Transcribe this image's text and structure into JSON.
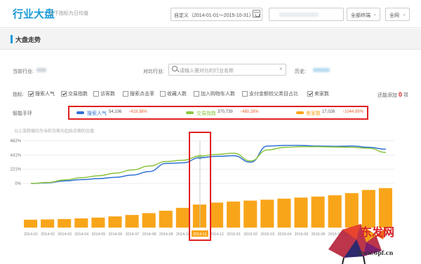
{
  "header": {
    "title": "行业大盘",
    "subtitle": "以下指标为日均值",
    "date_range": "自定义（2014-01-01～2015-10-31）",
    "terminal_select": "全部终端",
    "network_select": "全网"
  },
  "section": {
    "title": "大盘走势"
  },
  "filters": {
    "current_industry_label": "当前行业:",
    "compare_label": "对比行业:",
    "search_placeholder": "请输入需对比的行业名称",
    "history_label": "历史:"
  },
  "metrics": {
    "label": "指标:",
    "items": [
      {
        "label": "搜索人气",
        "checked": true
      },
      {
        "label": "交易指数",
        "checked": true
      },
      {
        "label": "访客数",
        "checked": false
      },
      {
        "label": "搜索点击率",
        "checked": false
      },
      {
        "label": "收藏人数",
        "checked": false
      },
      {
        "label": "加入购物车人数",
        "checked": false
      },
      {
        "label": "支付金额较父类目占比",
        "checked": false
      },
      {
        "label": "卖家数",
        "checked": true
      }
    ],
    "added_label": "还能添加",
    "added_count": "0",
    "added_unit": "项"
  },
  "legend": {
    "label": "智能手环",
    "series": [
      {
        "name": "搜索人气",
        "value": "54,106",
        "change": "419.38%",
        "color": "#2f72d4"
      },
      {
        "name": "交易指数",
        "value": "370,739",
        "change": "480.28%",
        "color": "#8dc63f"
      },
      {
        "name": "卖家数",
        "value": "17,026",
        "change": "1044.99%",
        "color": "#f9a51a"
      }
    ]
  },
  "note": "以上涨跌幅均为当前日期与起始日期的比值",
  "chart_data": {
    "type": "bar",
    "yticks": [
      "662%",
      "441%",
      "221%",
      "0%"
    ],
    "ylim": [
      0,
      662
    ],
    "categories": [
      "2014-01",
      "2014-02",
      "2014-03",
      "2014-04",
      "2014-05",
      "2014-06",
      "2014-07",
      "2014-08",
      "2014-09",
      "2014-10",
      "2014-11",
      "2014-12",
      "2015-01",
      "2015-02",
      "2015-03",
      "2015-04",
      "2015-05",
      "2015-06",
      "2015-07",
      "2015-08",
      "2015-09",
      "2015-10"
    ],
    "x_tick_labels": [
      "2014-01",
      "2014-02",
      "2014-03",
      "2014-04",
      "2014-05",
      "2014-06",
      "2014-07",
      "2014-08",
      "2014-09",
      "2014-10",
      "2014-11",
      "2014-12",
      "2015-01",
      "2015-02",
      "2015-03",
      "2015-04",
      "2015-05",
      "2015-06",
      "2015-07",
      "2015-08",
      "2015-09",
      "2015-10"
    ],
    "highlight_label": "2014-11",
    "series": [
      {
        "name": "卖家数",
        "type": "bar",
        "color": "#f9a51a",
        "values": [
          60,
          62,
          65,
          70,
          76,
          85,
          96,
          110,
          128,
          150,
          175,
          190,
          198,
          205,
          212,
          220,
          228,
          236,
          246,
          262,
          286,
          300
        ]
      },
      {
        "name": "搜索人气",
        "type": "line",
        "color": "#2f72d4",
        "values": [
          0,
          10,
          40,
          60,
          75,
          95,
          130,
          185,
          310,
          320,
          400,
          420,
          430,
          330,
          580,
          590,
          590,
          580,
          575,
          580,
          560,
          530
        ]
      },
      {
        "name": "交易指数",
        "type": "line",
        "color": "#8dc63f",
        "values": [
          0,
          15,
          55,
          90,
          120,
          160,
          210,
          270,
          340,
          360,
          425,
          450,
          470,
          350,
          520,
          560,
          570,
          570,
          565,
          560,
          545,
          480
        ]
      }
    ]
  },
  "watermark": {
    "text": "东发网",
    "url": "www.6pf.cn"
  }
}
